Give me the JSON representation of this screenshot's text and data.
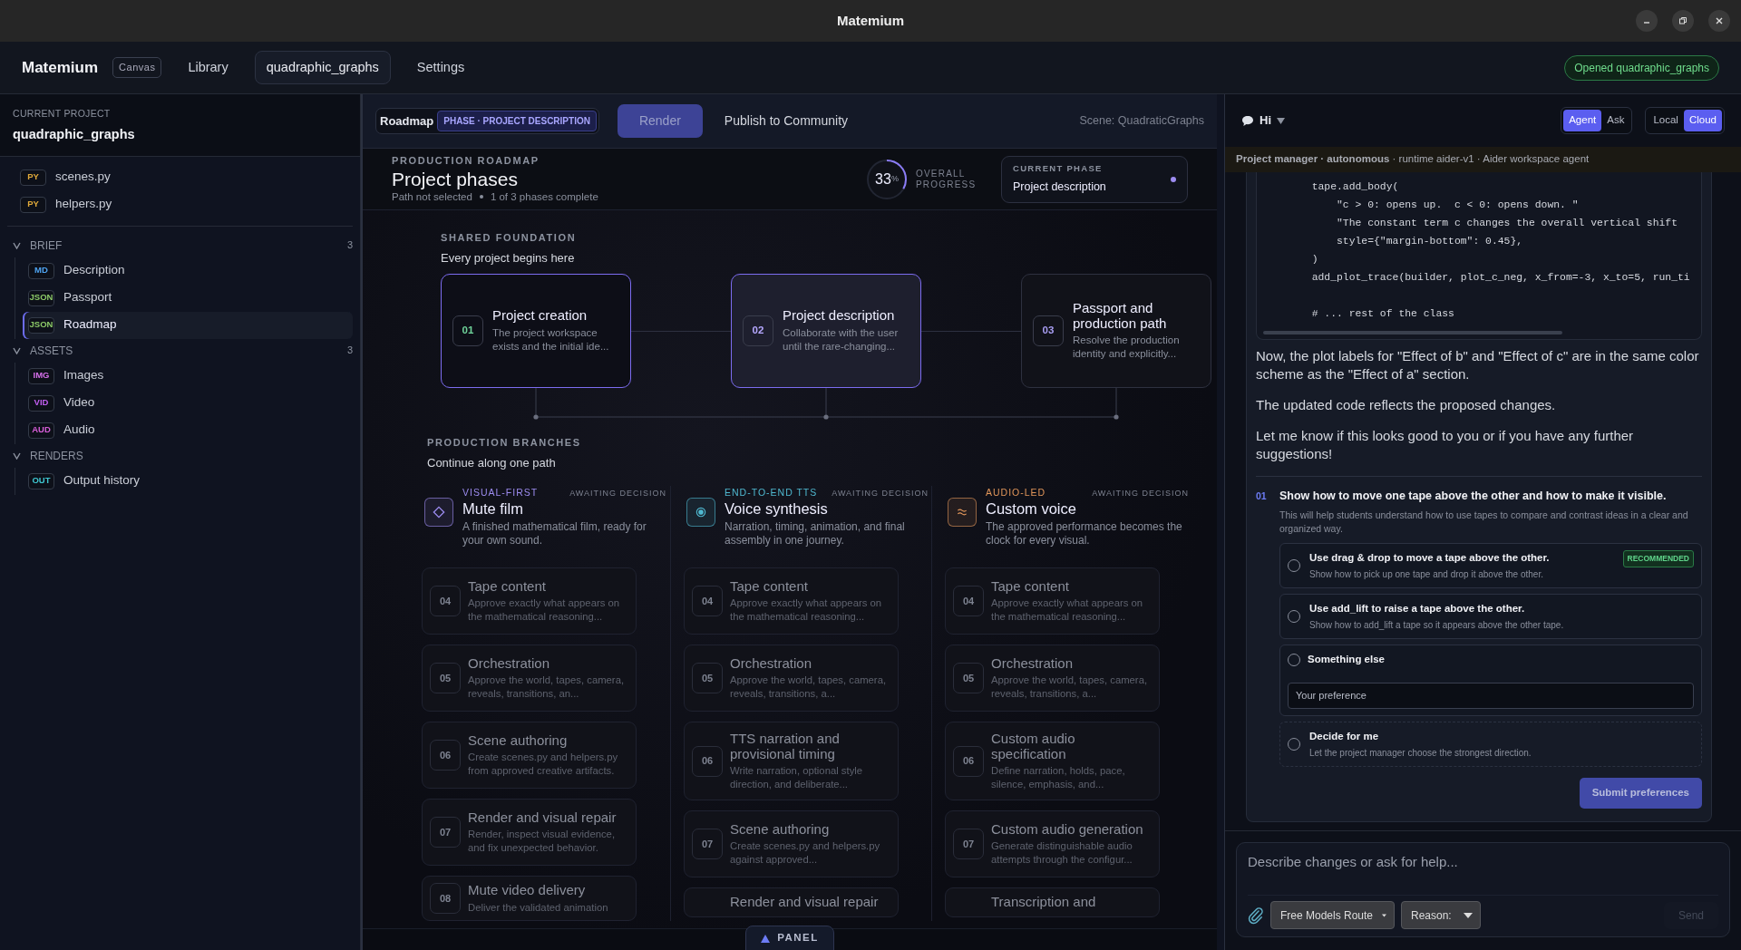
{
  "window": {
    "title": "Matemium"
  },
  "app_header": {
    "brand": "Matemium",
    "brand_badge": "Canvas",
    "nav": [
      {
        "label": "Library",
        "selected": false
      },
      {
        "label": "quadraphic_graphs",
        "selected": true
      },
      {
        "label": "Settings",
        "selected": false
      }
    ],
    "status": "Opened quadraphic_graphs"
  },
  "sidebar": {
    "project_label": "CURRENT PROJECT",
    "project_name": "quadraphic_graphs",
    "files": [
      {
        "tag": "PY",
        "name": "scenes.py",
        "color": "#e0a93a",
        "selected": false
      },
      {
        "tag": "PY",
        "name": "helpers.py",
        "color": "#e0a93a",
        "selected": false
      }
    ],
    "groups": [
      {
        "title": "BRIEF",
        "count": "3",
        "expanded": true,
        "items": [
          {
            "tag": "MD",
            "name": "Description",
            "color": "#4ea3f0",
            "selected": false
          },
          {
            "tag": "JSON",
            "name": "Passport",
            "color": "#8cc968",
            "selected": false
          },
          {
            "tag": "JSON",
            "name": "Roadmap",
            "color": "#8cc968",
            "selected": true
          }
        ]
      },
      {
        "title": "ASSETS",
        "count": "3",
        "expanded": true,
        "items": [
          {
            "tag": "IMG",
            "name": "Images",
            "color": "#d46ee8",
            "selected": false
          },
          {
            "tag": "VID",
            "name": "Video",
            "color": "#c25ef0",
            "selected": false
          },
          {
            "tag": "AUD",
            "name": "Audio",
            "color": "#d65ed8",
            "selected": false
          }
        ]
      },
      {
        "title": "RENDERS",
        "expanded": true,
        "items": [
          {
            "tag": "OUT",
            "name": "Output history",
            "color": "#3ec6d0",
            "selected": false
          }
        ]
      }
    ]
  },
  "toolbar": {
    "title": "Roadmap",
    "phase_badge": "PHASE · PROJECT DESCRIPTION",
    "buttons": [
      {
        "label": "Render",
        "kind": "primary"
      },
      {
        "label": "Publish to Community",
        "kind": "plain"
      }
    ],
    "scene": "Scene: QuadraticGraphs"
  },
  "roadmap": {
    "eyebrow": "PRODUCTION ROADMAP",
    "title": "Project phases",
    "path_status": "Path not selected",
    "phases_status": "1 of 3 phases complete",
    "progress": {
      "value": "33",
      "unit": "%",
      "level": 0.33,
      "label": "OVERALL PROGRESS"
    },
    "current_phase": {
      "label": "CURRENT PHASE",
      "value": "Project description"
    }
  },
  "foundation": {
    "eyebrow": "SHARED FOUNDATION",
    "title": "Every project begins here",
    "phases": [
      {
        "number": "01",
        "title": "Project creation",
        "description": "The project workspace exists and the initial ide...",
        "complete": true,
        "current": false
      },
      {
        "number": "02",
        "title": "Project description",
        "description": "Collaborate with the user until the rare-changing...",
        "complete": false,
        "current": true
      },
      {
        "number": "03",
        "title": "Passport and production path",
        "description": "Resolve the production identity and explicitly...",
        "complete": false,
        "current": false
      }
    ]
  },
  "branches": {
    "eyebrow": "PRODUCTION BRANCHES",
    "title": "Continue along one path",
    "paths": [
      {
        "tag": "VISUAL-FIRST",
        "color": "#9d8cf0",
        "status": "AWAITING DECISION",
        "title": "Mute film",
        "description": "A finished mathematical film, ready for your own sound.",
        "steps": [
          {
            "number": "04",
            "title": "Tape content",
            "description": "Approve exactly what appears on the mathematical reasoning..."
          },
          {
            "number": "05",
            "title": "Orchestration",
            "description": "Approve the world, tapes, camera, reveals, transitions, an..."
          },
          {
            "number": "06",
            "title": "Scene authoring",
            "description": "Create scenes.py and helpers.py from approved creative artifacts."
          },
          {
            "number": "07",
            "title": "Render and visual repair",
            "description": "Render, inspect visual evidence, and fix unexpected behavior."
          },
          {
            "number": "08",
            "title": "Mute video delivery",
            "description": "Deliver the validated animation"
          }
        ]
      },
      {
        "tag": "END-TO-END TTS",
        "color": "#4fb8d0",
        "status": "AWAITING DECISION",
        "title": "Voice synthesis",
        "description": "Narration, timing, animation, and final assembly in one journey.",
        "steps": [
          {
            "number": "04",
            "title": "Tape content",
            "description": "Approve exactly what appears on the mathematical reasoning..."
          },
          {
            "number": "05",
            "title": "Orchestration",
            "description": "Approve the world, tapes, camera, reveals, transitions, a..."
          },
          {
            "number": "06",
            "title": "TTS narration and provisional timing",
            "description": "Write narration, optional style direction, and deliberate..."
          },
          {
            "number": "07",
            "title": "Scene authoring",
            "description": "Create scenes.py and helpers.py against approved..."
          },
          {
            "title": "Render and visual repair"
          }
        ]
      },
      {
        "tag": "AUDIO-LED",
        "color": "#e0955a",
        "status": "AWAITING DECISION",
        "title": "Custom voice",
        "description": "The approved performance becomes the clock for every visual.",
        "steps": [
          {
            "number": "04",
            "title": "Tape content",
            "description": "Approve exactly what appears on the mathematical reasoning..."
          },
          {
            "number": "05",
            "title": "Orchestration",
            "description": "Approve the world, tapes, camera, reveals, transitions, a..."
          },
          {
            "number": "06",
            "title": "Custom audio specification",
            "description": "Define narration, holds, pace, silence, emphasis, and..."
          },
          {
            "number": "07",
            "title": "Custom audio generation",
            "description": "Generate distinguishable audio attempts through the configur..."
          },
          {
            "title": "Transcription and"
          }
        ]
      }
    ]
  },
  "panel_toggle": "PANEL",
  "chat": {
    "title": "Hi",
    "modes": [
      {
        "label": "Agent",
        "selected": true
      },
      {
        "label": "Ask",
        "selected": false
      }
    ],
    "targets": [
      {
        "label": "Local",
        "selected": false
      },
      {
        "label": "Cloud",
        "selected": true
      }
    ],
    "agent": "**Project manager · autonomous** · runtime aider-v1 · Aider workspace agent",
    "code": "        tape.add_body(\n            \"c > 0: opens up.  c < 0: opens down. \"\n            \"The constant term c changes the overall vertical shift\n            style={\"margin-bottom\": 0.45},\n        )\n        add_plot_trace(builder, plot_c_neg, x_from=-3, x_to=5, run_ti\n\n        # ... rest of the class",
    "paragraphs": [
      "Now, the plot labels for \"Effect of b\" and \"Effect of c\" are in the same color scheme as the \"Effect of a\" section.",
      "The updated code reflects the proposed changes.",
      "Let me know if this looks good to you or if you have any further suggestions!"
    ],
    "question": {
      "number": "01",
      "title": "Show how to move one tape above the other and how to make it visible.",
      "description": "This will help students understand how to use tapes to compare and contrast ideas in a clear and organized way.",
      "options": [
        {
          "kind": "choice",
          "title": "Use drag & drop to move a tape above the other.",
          "description": "Show how to pick up one tape and drop it above the other.",
          "badge": "RECOMMENDED",
          "selected": false
        },
        {
          "kind": "choice",
          "title": "Use add_lift to raise a tape above the other.",
          "description": "Show how to add_lift a tape so it appears above the other tape.",
          "selected": false
        },
        {
          "kind": "custom",
          "title": "Something else",
          "placeholder": "Your preference",
          "selected": false
        },
        {
          "kind": "auto",
          "title": "Decide for me",
          "description": "Let the project manager choose the strongest direction.",
          "selected": false
        }
      ],
      "submit": "Submit preferences"
    },
    "composer": {
      "placeholder": "Describe changes or ask for help...",
      "model": "Free Models Route",
      "reasoning": "Reason:",
      "send": "Send"
    }
  }
}
